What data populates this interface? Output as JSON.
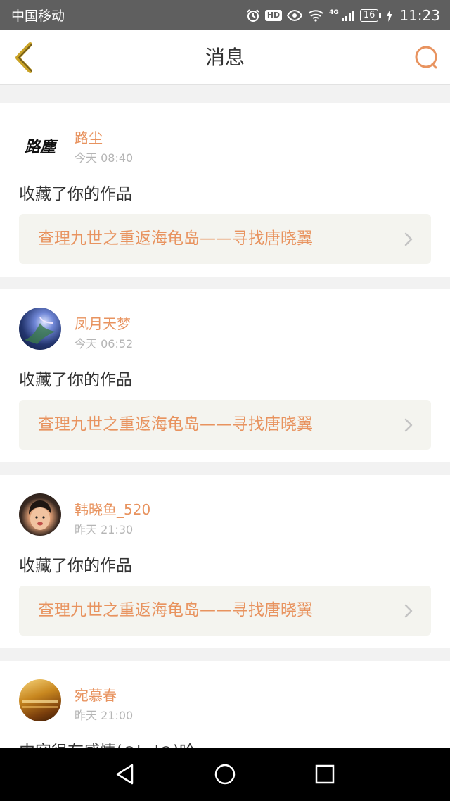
{
  "status_bar": {
    "carrier": "中国移动",
    "hd_label": "HD",
    "network": "4G",
    "battery": "16",
    "time": "11:23"
  },
  "header": {
    "title": "消息"
  },
  "messages": [
    {
      "user": "路尘",
      "time": "今天 08:40",
      "text": "收藏了你的作品",
      "work_title": "查理九世之重返海龟岛——寻找唐晓翼",
      "avatar_text": "路塵"
    },
    {
      "user": "凤月天梦",
      "time": "今天 06:52",
      "text": "收藏了你的作品",
      "work_title": "查理九世之重返海龟岛——寻找唐晓翼"
    },
    {
      "user": "韩晓鱼_520",
      "time": "昨天 21:30",
      "text": "收藏了你的作品",
      "work_title": "查理九世之重返海龟岛——寻找唐晓翼"
    },
    {
      "user": "宛慕春",
      "time": "昨天 21:00",
      "text": "内容很有感情(○'ω'○)哈"
    }
  ],
  "colors": {
    "accent": "#e8935f",
    "status_bar": "#5f5f5f",
    "background": "#f2f2f2",
    "link_background": "#f4f4ef"
  }
}
